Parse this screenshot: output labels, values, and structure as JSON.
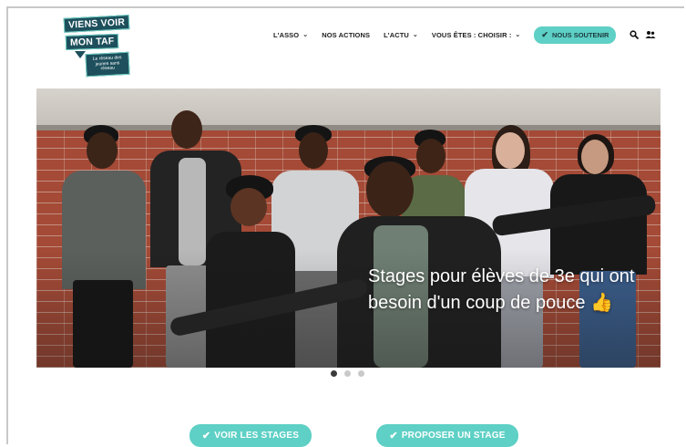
{
  "logo": {
    "line1": "VIENS VOIR",
    "line2": "MON TAF",
    "tagline": "Le réseau des jeunes sans réseau"
  },
  "nav": {
    "items": [
      {
        "label": "L'ASSO",
        "has_dropdown": true
      },
      {
        "label": "NOS ACTIONS",
        "has_dropdown": false
      },
      {
        "label": "L'ACTU",
        "has_dropdown": true
      },
      {
        "label": "VOUS ÊTES : CHOISIR :",
        "has_dropdown": true
      }
    ],
    "cta_label": "NOUS SOUTENIR",
    "icons": [
      "search-icon",
      "users-icon"
    ]
  },
  "hero": {
    "text": "Stages pour élèves de 3e qui ont besoin d'un coup de pouce 👍",
    "slide_count": 3,
    "active_slide": 1
  },
  "buttons": {
    "primary": "VOIR LES STAGES",
    "secondary": "PROPOSER UN STAGE"
  },
  "colors": {
    "accent": "#5ed0c5",
    "logo_bg": "#1d4f5c",
    "brick": "#a44a36"
  }
}
